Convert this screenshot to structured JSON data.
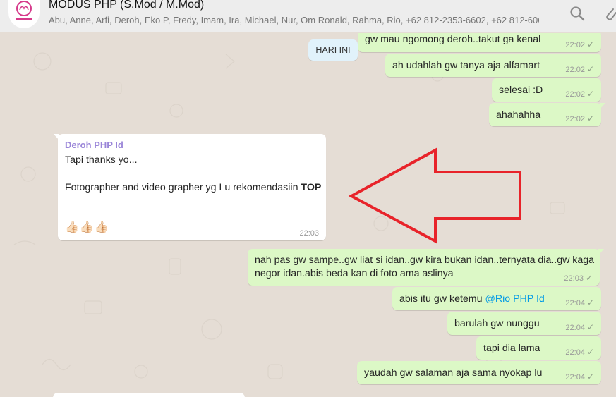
{
  "header": {
    "title": "MODUS PHP (S.Mod / M.Mod)",
    "participants": "Abu, Anne, Arfi, Deroh, Eko P, Fredy, Imam, Ira, Michael, Nur, Om Ronald, Rahma, Rio, +62 812-2353-6602, +62 812-6068-..."
  },
  "icons": {
    "search": "search-icon",
    "attach": "paperclip-icon",
    "avatar": "group-avatar-logo"
  },
  "colors": {
    "outgoing": "#dcf8c6",
    "incoming": "#ffffff",
    "sender": "#9a85d8",
    "arrow": "#e8232a",
    "mention": "#039be5"
  },
  "date_chip": "HARI INI",
  "messages": {
    "m1": {
      "text": "gw mau ngomong deroh..takut ga kenal",
      "time": "22:02"
    },
    "m2": {
      "text": "ah udahlah gw tanya aja alfamart",
      "time": "22:02"
    },
    "m3": {
      "text": "selesai :D",
      "time": "22:02"
    },
    "m4": {
      "text": "ahahahha",
      "time": "22:02"
    },
    "m5": {
      "sender": "Deroh PHP Id",
      "line1": "Tapi thanks yo...",
      "line2_prefix": "Fotographer and video grapher yg Lu rekomendasiin ",
      "line2_bold": "TOP",
      "emoji": "👍🏻👍🏻👍🏻",
      "time": "22:03"
    },
    "m6": {
      "line1": "nah pas gw sampe..gw liat si idan..gw kira bukan idan..ternyata dia..gw kaga",
      "line2": "negor idan.abis beda kan di foto ama aslinya",
      "time": "22:03"
    },
    "m7": {
      "text": "abis itu gw ketemu ",
      "mention": "@Rio PHP Id",
      "time": "22:04"
    },
    "m8": {
      "text": "barulah gw nunggu",
      "time": "22:04"
    },
    "m9": {
      "text": "tapi dia lama",
      "time": "22:04"
    },
    "m10": {
      "text": "yaudah gw salaman aja sama nyokap lu",
      "time": "22:04"
    }
  }
}
